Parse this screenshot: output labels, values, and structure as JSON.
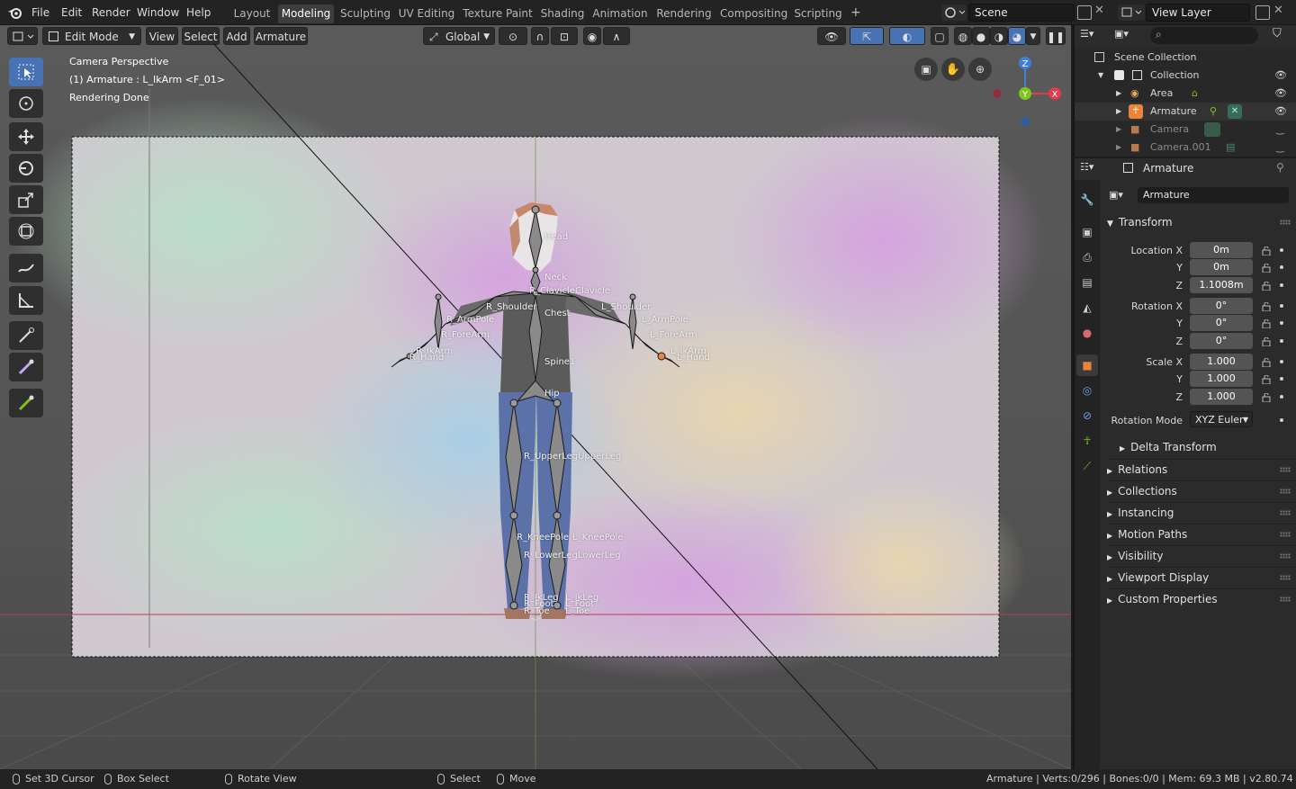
{
  "menu": [
    "File",
    "Edit",
    "Render",
    "Window",
    "Help"
  ],
  "workspaces": [
    "Layout",
    "Modeling",
    "Sculpting",
    "UV Editing",
    "Texture Paint",
    "Shading",
    "Animation",
    "Rendering",
    "Compositing",
    "Scripting"
  ],
  "active_workspace": "Modeling",
  "scene_name": "Scene",
  "view_layer": "View Layer",
  "viewport": {
    "mode": "Edit Mode",
    "menus": [
      "View",
      "Select",
      "Add",
      "Armature"
    ],
    "orientation": "Global",
    "overlay_lines": [
      "Camera Perspective",
      "(1) Armature : L_IkArm <F_01>",
      "Rendering Done"
    ],
    "gizmo_axes": {
      "z": "Z",
      "y": "Y",
      "x": "X"
    }
  },
  "bones": [
    {
      "id": "head",
      "label": "Head"
    },
    {
      "id": "neck",
      "label": "Neck"
    },
    {
      "id": "clavicle",
      "label": "R_ClavicleClavicle"
    },
    {
      "id": "r_shoulder",
      "label": "R_Shoulder"
    },
    {
      "id": "l_shoulder",
      "label": "L_Shoulder"
    },
    {
      "id": "chest",
      "label": "Chest"
    },
    {
      "id": "r_armpole",
      "label": "R_ArmPole"
    },
    {
      "id": "l_armpole",
      "label": "L_ArmPole"
    },
    {
      "id": "r_forearm",
      "label": "R_ForeArm"
    },
    {
      "id": "l_forearm",
      "label": "L_ForeArm"
    },
    {
      "id": "r_ikarm",
      "label": "R_IkArm"
    },
    {
      "id": "r_hand",
      "label": "R_Hand"
    },
    {
      "id": "l_ikarm",
      "label": "L_IkArm"
    },
    {
      "id": "l_hand",
      "label": "L_Hand"
    },
    {
      "id": "spine1",
      "label": "Spine1"
    },
    {
      "id": "hip",
      "label": "Hip"
    },
    {
      "id": "upperleg",
      "label": "R_UpperLegUpperLeg"
    },
    {
      "id": "r_kneepole",
      "label": "R_KneePole"
    },
    {
      "id": "l_kneepole",
      "label": "L_KneePole"
    },
    {
      "id": "lowerleg",
      "label": "R_LowerLegLowerLeg"
    },
    {
      "id": "r_ikleg",
      "label": "R_IkLeg"
    },
    {
      "id": "l_ikleg",
      "label": "L_IkLeg"
    },
    {
      "id": "r_foot",
      "label": "R_Foot"
    },
    {
      "id": "l_foot",
      "label": "L_Foot"
    },
    {
      "id": "r_toe",
      "label": "R_Toe"
    },
    {
      "id": "l_toe",
      "label": "L_Toe"
    }
  ],
  "outliner": {
    "root": "Scene Collection",
    "items": [
      {
        "name": "Collection",
        "icon": "collection-icon",
        "level": 1
      },
      {
        "name": "Area",
        "icon": "light-icon",
        "level": 2
      },
      {
        "name": "Armature",
        "icon": "armature-icon",
        "level": 2
      },
      {
        "name": "Camera",
        "icon": "camera-icon",
        "level": 2
      },
      {
        "name": "Camera.001",
        "icon": "camera-icon",
        "level": 2
      }
    ]
  },
  "properties": {
    "context_name": "Armature",
    "object_name": "Armature",
    "transform_title": "Transform",
    "location_x_label": "Location X",
    "rotation_x_label": "Rotation X",
    "scale_x_label": "Scale X",
    "y_label": "Y",
    "z_label": "Z",
    "location": [
      "0m",
      "0m",
      "1.1008m"
    ],
    "rotation": [
      "0°",
      "0°",
      "0°"
    ],
    "scale": [
      "1.000",
      "1.000",
      "1.000"
    ],
    "rotation_mode_label": "Rotation Mode",
    "rotation_mode": "XYZ Euler",
    "delta_transform": "Delta Transform",
    "panels": [
      "Relations",
      "Collections",
      "Instancing",
      "Motion Paths",
      "Visibility",
      "Viewport Display",
      "Custom Properties"
    ]
  },
  "statusbar": {
    "left": [
      "Set 3D Cursor",
      "Box Select",
      "Rotate View",
      "Select",
      "Move"
    ],
    "right": "Armature | Verts:0/296 | Bones:0/0 | Mem: 69.3 MB | v2.80.74"
  },
  "colors": {
    "accent": "#4772b3",
    "x_axis": "#e23b4a",
    "y_axis": "#7ec41c",
    "z_axis": "#3f7fd8",
    "bone_selected": "#e8853a"
  }
}
